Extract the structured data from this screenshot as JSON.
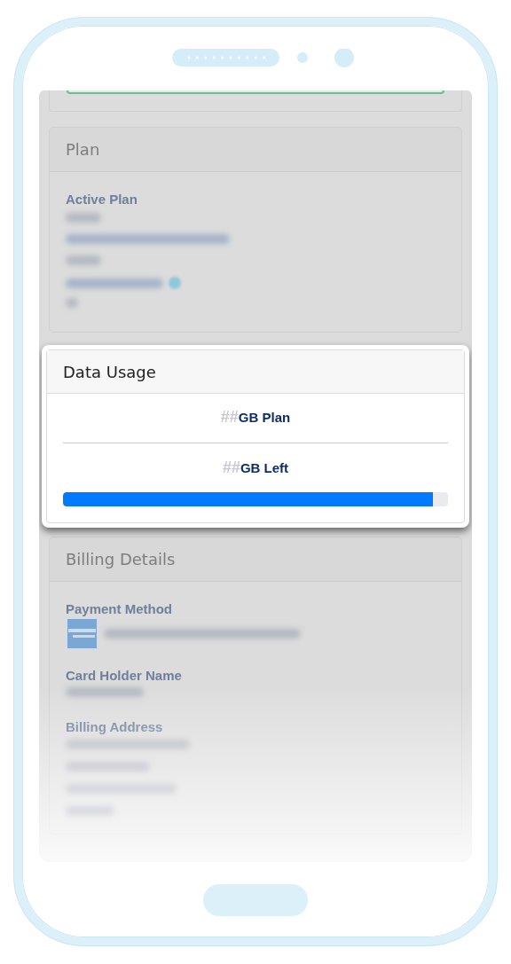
{
  "top_card": {
    "kind": "partial"
  },
  "plan_card": {
    "title": "Plan",
    "label": "Active Plan"
  },
  "data_usage": {
    "title": "Data Usage",
    "plan": {
      "mark": "##",
      "text": "GB Plan"
    },
    "left": {
      "mark": "##",
      "text": "GB Left"
    },
    "usage_bar": {
      "level": 0.96
    }
  },
  "billing_card": {
    "title": "Billing Details",
    "labels": [
      "Payment Method",
      "Card Holder Name",
      "Billing Address"
    ]
  }
}
